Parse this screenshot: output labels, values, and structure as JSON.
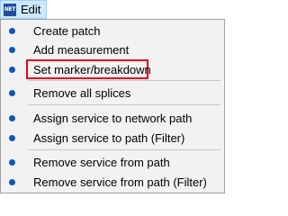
{
  "menubar": {
    "app_icon_text": "NET",
    "menu_title": "Edit"
  },
  "menu": {
    "items": [
      {
        "label": "Create patch"
      },
      {
        "label": "Add measurement"
      },
      {
        "label": "Set marker/breakdown",
        "highlighted": true
      },
      {
        "label": "Remove all splices"
      },
      {
        "label": "Assign service to network path"
      },
      {
        "label": "Assign service to path (Filter)"
      },
      {
        "label": "Remove service from path"
      },
      {
        "label": "Remove service from path (Filter)"
      }
    ]
  },
  "colors": {
    "menu_head_bg": "#cce8ff",
    "bullet": "#0e56b7",
    "highlight_border": "#e8001c",
    "dropdown_bg": "#f2f2f2"
  }
}
